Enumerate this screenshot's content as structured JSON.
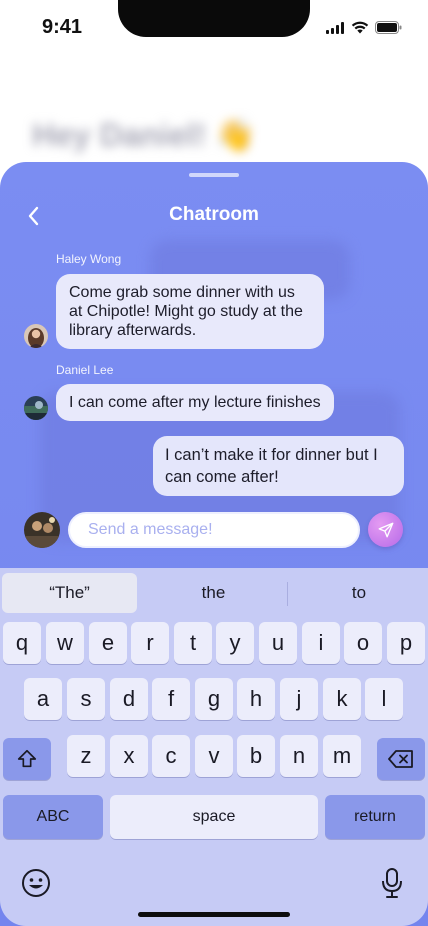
{
  "status_bar": {
    "time": "9:41"
  },
  "background": {
    "greeting": "Hey Daniel! 👋"
  },
  "chat": {
    "title": "Chatroom",
    "messages": [
      {
        "sender": "Haley Wong",
        "text": "Come grab some dinner with us at Chipotle! Might go study at the library afterwards."
      },
      {
        "sender": "Daniel Lee",
        "text": "I can come after my lecture finishes"
      },
      {
        "sender": "",
        "text": "I can’t make it for dinner but I can come after!"
      }
    ],
    "input_placeholder": "Send a message!"
  },
  "keyboard": {
    "suggestions": [
      "“The”",
      "the",
      "to"
    ],
    "row1": [
      "q",
      "w",
      "e",
      "r",
      "t",
      "y",
      "u",
      "i",
      "o",
      "p"
    ],
    "row2": [
      "a",
      "s",
      "d",
      "f",
      "g",
      "h",
      "j",
      "k",
      "l"
    ],
    "row3": [
      "z",
      "x",
      "c",
      "v",
      "b",
      "n",
      "m"
    ],
    "abc_label": "ABC",
    "space_label": "space",
    "return_label": "return"
  },
  "colors": {
    "panel": "#7b8df2",
    "keyboard": "#c6cbf5",
    "send": "#c47ae9"
  }
}
